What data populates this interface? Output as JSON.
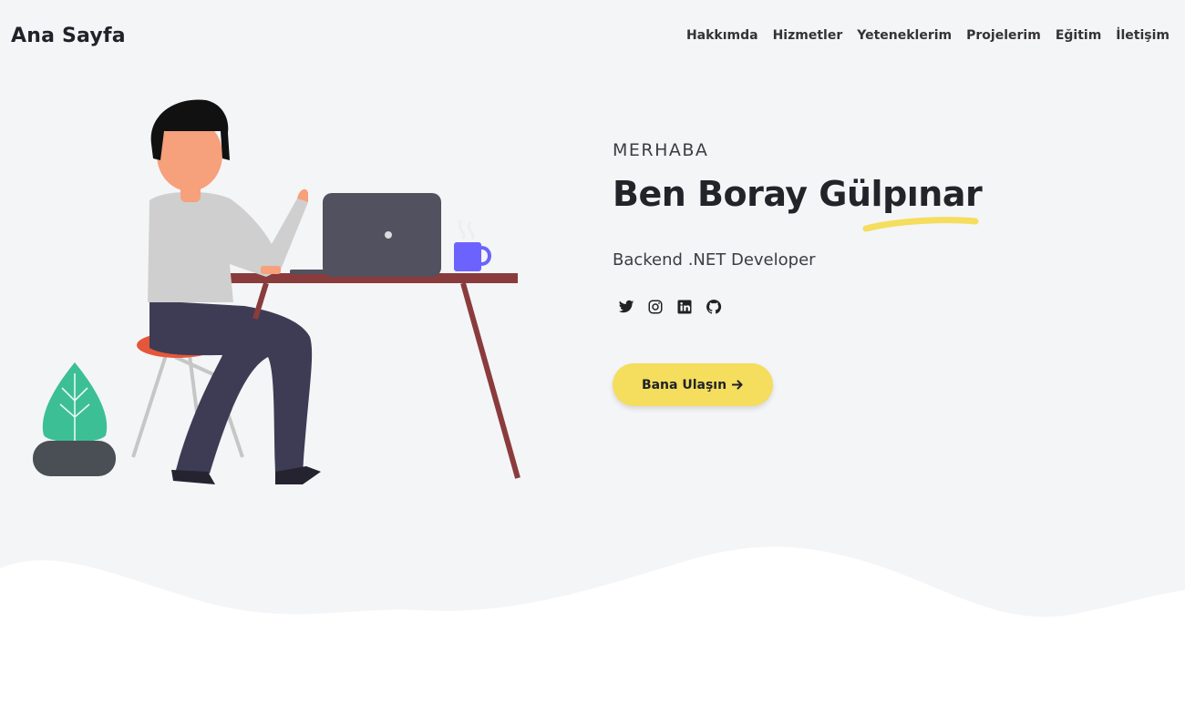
{
  "navbar": {
    "brand": "Ana Sayfa",
    "links": [
      "Hakkımda",
      "Hizmetler",
      "Yeteneklerim",
      "Projelerim",
      "Eğitim",
      "İletişim"
    ]
  },
  "hero": {
    "greeting": "MERHABA",
    "name": "Ben Boray Gülpınar",
    "role": "Backend .NET Developer",
    "cta_label": "Bana Ulaşın",
    "social_icons": [
      "twitter-icon",
      "instagram-icon",
      "linkedin-icon",
      "github-icon"
    ]
  },
  "colors": {
    "accent": "#f5dd5d",
    "hero_background": "#f4f5f7",
    "text_dark": "#212529"
  }
}
